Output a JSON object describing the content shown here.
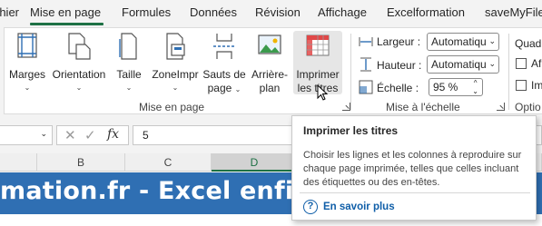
{
  "tabs": [
    {
      "label": "Fichier"
    },
    {
      "label": "Mise en page"
    },
    {
      "label": "Formules"
    },
    {
      "label": "Données"
    },
    {
      "label": "Révision"
    },
    {
      "label": "Affichage"
    },
    {
      "label": "Excelformation"
    },
    {
      "label": "saveMyFile"
    }
  ],
  "active_tab": "Mise en page",
  "ribbon": {
    "mise_en_page": {
      "group_label": "Mise en page",
      "buttons": {
        "marges": "Marges",
        "orientation": "Orientation",
        "taille": "Taille",
        "zone_line1": "ZoneImpr",
        "sauts_line1": "Sauts de",
        "sauts_line2": "page",
        "arriere_line1": "Arrière-",
        "arriere_line2": "plan",
        "imprimer_line1": "Imprimer",
        "imprimer_line2": "les titres"
      }
    },
    "mise_a_echelle": {
      "group_label": "Mise à l'échelle",
      "largeur_label": "Largeur :",
      "largeur_value": "Automatiqu",
      "hauteur_label": "Hauteur :",
      "hauteur_value": "Automatiqu",
      "echelle_label": "Échelle :",
      "echelle_value": "95 %"
    },
    "options": {
      "group_label": "Optio",
      "quadrillage_label": "Quadr",
      "afficher_label": "Af",
      "imprimer_label": "Im"
    }
  },
  "formula_bar": {
    "fx_label": "fx",
    "value": "5"
  },
  "columns": [
    "B",
    "C",
    "D"
  ],
  "selected_column": "D",
  "banner_text": "mation.fr - Excel enfin à",
  "tooltip": {
    "title": "Imprimer les titres",
    "body": "Choisir les lignes et les colonnes à reproduire sur chaque page imprimée, telles que celles incluant des étiquettes ou des en-têtes.",
    "link": "En savoir plus"
  },
  "colors": {
    "accent": "#1e7145",
    "banner": "#2f6fb3",
    "link": "#0f5ea8"
  }
}
